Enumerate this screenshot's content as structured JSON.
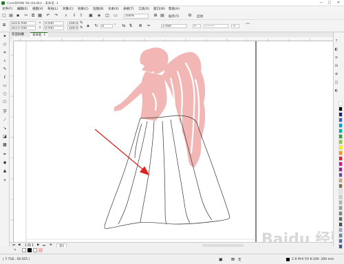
{
  "window": {
    "title": "CorelDRAW X8 (64-Bit) - 未命名 -1",
    "minimize": "—",
    "maximize": "□",
    "close": "✕"
  },
  "menu": [
    "文件(F)",
    "编辑(E)",
    "视图(V)",
    "布局(L)",
    "对象(C)",
    "效果(C)",
    "位图(B)",
    "文本(X)",
    "表格(T)",
    "工具(O)",
    "窗口(W)",
    "帮助(H)"
  ],
  "toolbar": {
    "zoom": "100%",
    "snap": "贴齐(T)",
    "launch": "启动"
  },
  "property_bar": {
    "x": "103.6 mm",
    "y": "143.5 mm",
    "width": "0 mm",
    "height": "0 mm",
    "scale_w": "100.0",
    "scale_h": "100.0",
    "pct": "%",
    "angle": "0",
    "angle_unit": "°",
    "outline_width": "2 mm"
  },
  "document_tabs": [
    {
      "label": "欢迎屏幕"
    },
    {
      "label": "未命名 -1"
    }
  ],
  "page_nav": {
    "count_label": "1 的 1",
    "page_tab": "页1"
  },
  "status": {
    "coordinates": "( 7.718 , 56.055 )",
    "fill_label": "无",
    "outline_info": "C:0 M:0 Y:0 K:100  .200 mm"
  },
  "watermark": "Baidu 经验",
  "colors": {
    "figure_fill": "#f2b6b5",
    "arrow": "#e02020",
    "palette": [
      "#ffffff",
      "#000000",
      "#1e1e6e",
      "#3a5fcd",
      "#00a0e0",
      "#00b0a0",
      "#2e9e3e",
      "#8dc63f",
      "#fff200",
      "#f7941d",
      "#ed1c24",
      "#ec008c",
      "#92278f",
      "#6d4b9f",
      "#c8a882",
      "#8b6b4e",
      "#e6e6e6",
      "#cccccc",
      "#b3b3b3",
      "#999999",
      "#808080",
      "#666666",
      "#4d4d4d",
      "#9aa6b8",
      "#6f7fa0",
      "#53709c",
      "#405a88"
    ]
  }
}
